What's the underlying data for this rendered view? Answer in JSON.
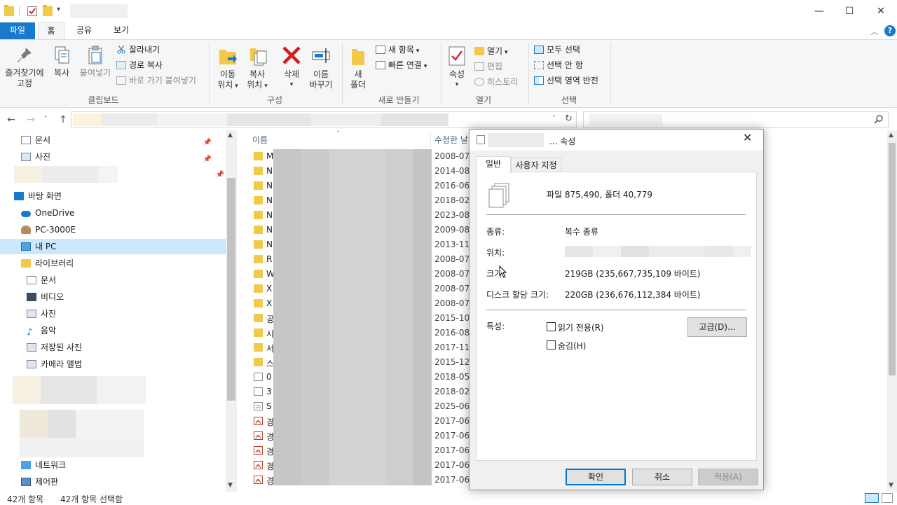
{
  "window": {
    "minimize_glyph": "—",
    "maximize_glyph": "☐",
    "close_glyph": "✕"
  },
  "ribbon_tabs": [
    "파일",
    "홈",
    "공유",
    "보기"
  ],
  "ribbon": {
    "clipboard": {
      "pin_label_1": "즐겨찾기에",
      "pin_label_2": "고정",
      "copy_label": "복사",
      "paste_label": "붙여넣기",
      "cut_label": "잘라내기",
      "copy_path_label": "경로 복사",
      "paste_shortcut_label": "바로 가기 붙여넣기",
      "group_label": "클립보드"
    },
    "organize": {
      "move_label_1": "이동",
      "move_label_2": "위치",
      "copyto_label_1": "복사",
      "copyto_label_2": "위치",
      "delete_label": "삭제",
      "rename_label_1": "이름",
      "rename_label_2": "바꾸기",
      "group_label": "구성"
    },
    "new": {
      "new_folder_label_1": "새",
      "new_folder_label_2": "폴더",
      "new_item_label": "새 항목",
      "easy_access_label": "빠른 연결",
      "group_label": "새로 만들기"
    },
    "open": {
      "properties_label": "속성",
      "open_label": "열기",
      "edit_label": "편집",
      "history_label": "히스토리",
      "group_label": "열기"
    },
    "select": {
      "select_all_label": "모두 선택",
      "select_none_label": "선택 안 함",
      "invert_label": "선택 영역 반전",
      "group_label": "선택"
    }
  },
  "nav": {
    "items": [
      {
        "label": "문서"
      },
      {
        "label": "사진"
      },
      {
        "label": "바탕 화면"
      },
      {
        "label": "OneDrive"
      },
      {
        "label": "PC-3000E"
      },
      {
        "label": "내 PC"
      },
      {
        "label": "라이브러리"
      },
      {
        "label": "문서"
      },
      {
        "label": "비디오"
      },
      {
        "label": "사진"
      },
      {
        "label": "음악"
      },
      {
        "label": "저장된 사진"
      },
      {
        "label": "카메라 앨범"
      },
      {
        "label": "네트워크"
      },
      {
        "label": "제어판"
      }
    ]
  },
  "filelist": {
    "col_name": "이름",
    "col_modified": "수정한 날",
    "rows": [
      {
        "initial": "M",
        "date": "2008-07",
        "kind": "folder"
      },
      {
        "initial": "N",
        "date": "2014-08",
        "kind": "folder"
      },
      {
        "initial": "N",
        "date": "2016-06",
        "kind": "folder"
      },
      {
        "initial": "N",
        "date": "2018-02",
        "kind": "folder"
      },
      {
        "initial": "N",
        "date": "2023-08",
        "kind": "folder"
      },
      {
        "initial": "N",
        "date": "2009-08",
        "kind": "folder"
      },
      {
        "initial": "N",
        "date": "2013-11",
        "kind": "folder"
      },
      {
        "initial": "R",
        "date": "2008-07",
        "kind": "folder"
      },
      {
        "initial": "W",
        "date": "2008-07",
        "kind": "folder"
      },
      {
        "initial": "X",
        "date": "2008-07",
        "kind": "folder"
      },
      {
        "initial": "X",
        "date": "2008-07",
        "kind": "folder"
      },
      {
        "initial": "공",
        "date": "2015-10",
        "kind": "folder"
      },
      {
        "initial": "시",
        "date": "2016-08",
        "kind": "folder"
      },
      {
        "initial": "서",
        "date": "2017-11",
        "kind": "folder"
      },
      {
        "initial": "스",
        "date": "2015-12",
        "kind": "folder"
      },
      {
        "initial": "0",
        "date": "2018-05",
        "kind": "file"
      },
      {
        "initial": "3",
        "date": "2018-02",
        "kind": "file"
      },
      {
        "initial": "S",
        "date": "2025-06",
        "kind": "doc"
      },
      {
        "initial": "경",
        "date": "2017-06",
        "kind": "pdf"
      },
      {
        "initial": "경",
        "date": "2017-06",
        "kind": "pdf"
      },
      {
        "initial": "경",
        "date": "2017-06",
        "kind": "pdf"
      },
      {
        "initial": "경",
        "date": "2017-06",
        "kind": "pdf"
      },
      {
        "initial": "경",
        "date": "2017-06",
        "kind": "pdf"
      }
    ]
  },
  "status": {
    "count": "42개 항목",
    "selected": "42개 항목 선택함"
  },
  "dialog": {
    "title_suffix": "... 속성",
    "tab_general": "일반",
    "tab_custom": "사용자 지정",
    "summary": "파일 875,490, 폴더 40,779",
    "type_label": "종류:",
    "type_value": "복수 종류",
    "location_label": "위치:",
    "size_label": "크기:",
    "size_value": "219GB (235,667,735,109 바이트)",
    "disk_size_label": "디스크 할당 크기:",
    "disk_size_value": "220GB (236,676,112,384 바이트)",
    "attributes_label": "특성:",
    "readonly_label": "읽기 전용(R)",
    "hidden_label": "숨김(H)",
    "advanced_label": "고급(D)...",
    "ok_label": "확인",
    "cancel_label": "취소",
    "apply_label": "적용(A)"
  },
  "colors": {
    "accent": "#1979ca",
    "folder": "#f3c94a",
    "selected_row": "#cce8ff",
    "pdf_red": "#c0392b"
  }
}
